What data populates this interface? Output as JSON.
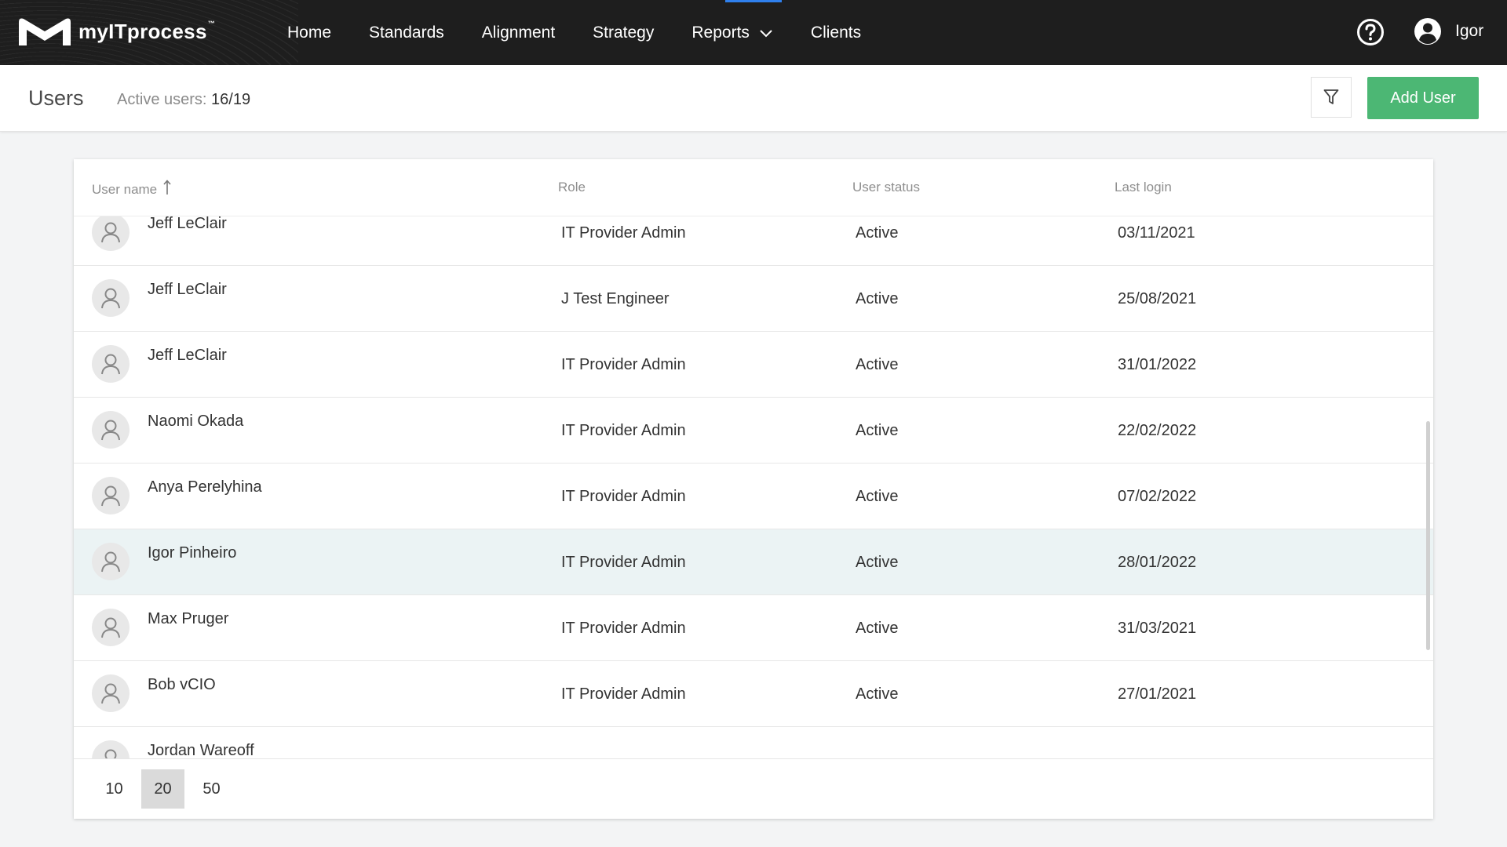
{
  "app": {
    "logo_text": "myITprocess",
    "logo_tm": "™",
    "nav": [
      "Home",
      "Standards",
      "Alignment",
      "Strategy",
      "Reports",
      "Clients"
    ],
    "user_name": "Igor",
    "icons": {
      "logo": "m-logo-icon",
      "help": "help-circle-icon",
      "user": "user-circle-icon",
      "dropdown": "chevron-down-icon"
    }
  },
  "page": {
    "title": "Users",
    "active_label": "Active users:",
    "active_value": "16/19",
    "add_button": "Add User"
  },
  "table": {
    "headers": [
      "User name",
      "Role",
      "User status",
      "Last login"
    ],
    "sort": "ascending",
    "rows": [
      {
        "name": "Jeff LeClair",
        "role": "IT Provider Admin",
        "status": "Active",
        "last_login": "03/11/2021"
      },
      {
        "name": "Jeff LeClair",
        "role": "J Test Engineer",
        "status": "Active",
        "last_login": "25/08/2021"
      },
      {
        "name": "Jeff LeClair",
        "role": "IT Provider Admin",
        "status": "Active",
        "last_login": "31/01/2022"
      },
      {
        "name": "Naomi Okada",
        "role": "IT Provider Admin",
        "status": "Active",
        "last_login": "22/02/2022"
      },
      {
        "name": "Anya Perelyhina",
        "role": "IT Provider Admin",
        "status": "Active",
        "last_login": "07/02/2022"
      },
      {
        "name": "Igor Pinheiro",
        "role": "IT Provider Admin",
        "status": "Active",
        "last_login": "28/01/2022"
      },
      {
        "name": "Max Pruger",
        "role": "IT Provider Admin",
        "status": "Active",
        "last_login": "31/03/2021"
      },
      {
        "name": "Bob vCIO",
        "role": "IT Provider Admin",
        "status": "Active",
        "last_login": "27/01/2021"
      },
      {
        "name": "Jordan Wareoff",
        "role": "",
        "status": "",
        "last_login": ""
      }
    ],
    "highlighted_row": 5,
    "page_sizes": [
      "10",
      "20",
      "50"
    ],
    "selected_page_size": "20"
  },
  "colors": {
    "topbar": "#1e1e1e",
    "accent_green": "#4cb774",
    "nav_indicator": "#2f80ed",
    "row_highlight": "#ebf3f4"
  }
}
